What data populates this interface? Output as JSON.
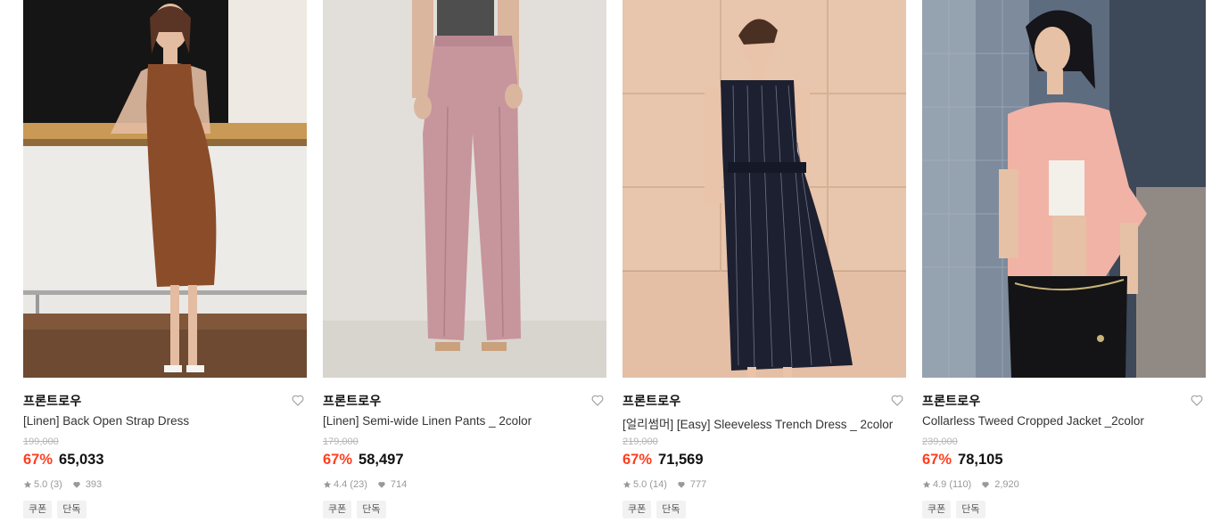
{
  "products": [
    {
      "brand": "프론트로우",
      "name": "[Linen] Back Open Strap Dress",
      "original_price": "199,000",
      "discount": "67%",
      "price": "65,033",
      "rating": "5.0",
      "reviews": "(3)",
      "likes": "393",
      "tags": [
        "쿠폰",
        "단독"
      ],
      "image_subject": "model-in-brown-linen-strap-dress"
    },
    {
      "brand": "프론트로우",
      "name": "[Linen] Semi-wide Linen Pants _ 2color",
      "original_price": "179,000",
      "discount": "67%",
      "price": "58,497",
      "rating": "4.4",
      "reviews": "(23)",
      "likes": "714",
      "tags": [
        "쿠폰",
        "단독"
      ],
      "image_subject": "model-in-pink-linen-pants"
    },
    {
      "brand": "프론트로우",
      "name": "[얼리썸머] [Easy] Sleeveless Trench Dress _ 2color",
      "original_price": "219,000",
      "discount": "67%",
      "price": "71,569",
      "rating": "5.0",
      "reviews": "(14)",
      "likes": "777",
      "tags": [
        "쿠폰",
        "단독"
      ],
      "image_subject": "model-in-navy-pinstripe-sleeveless-dress"
    },
    {
      "brand": "프론트로우",
      "name": "Collarless Tweed Cropped Jacket _2color",
      "original_price": "239,000",
      "discount": "67%",
      "price": "78,105",
      "rating": "4.9",
      "reviews": "(110)",
      "likes": "2,920",
      "tags": [
        "쿠폰",
        "단독"
      ],
      "image_subject": "model-in-pink-tweed-cropped-jacket"
    }
  ],
  "colors": {
    "discount": "#ff3e1f",
    "original_price": "#b5b5b5",
    "meta_text": "#999999",
    "tag_bg": "#f2f2f2"
  },
  "icons": {
    "wishlist": "heart-outline-icon",
    "rating": "star-icon",
    "likes": "heart-filled-icon"
  }
}
